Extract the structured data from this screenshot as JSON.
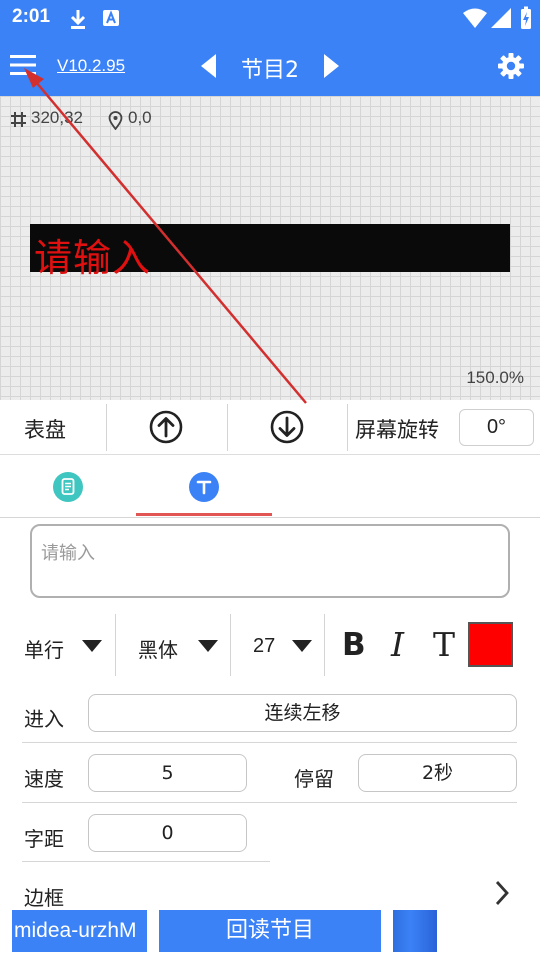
{
  "status_bar": {
    "time": "2:01"
  },
  "app_bar": {
    "version": "V10.2.95",
    "program_title": "节目2"
  },
  "canvas": {
    "size_readout": "320,32",
    "position_readout": "0,0",
    "led_text": "请输入",
    "led_text_color": "#e01010",
    "zoom": "150.0%"
  },
  "controls": {
    "dial_label": "表盘",
    "rotate_label": "屏幕旋转",
    "rotate_value": "0°"
  },
  "tabs": [
    {
      "icon": "document-icon",
      "active": false
    },
    {
      "icon": "text-t-icon",
      "active": true
    }
  ],
  "text_editor": {
    "placeholder": "请输入",
    "value": ""
  },
  "font_row": {
    "line_mode": "单行",
    "font_family": "黑体",
    "font_size": "27",
    "bold_label": "B",
    "italic_label": "I",
    "text_label": "T",
    "color": "#ff0000"
  },
  "form": {
    "enter_label": "进入",
    "enter_value": "连续左移",
    "speed_label": "速度",
    "speed_value": "5",
    "stay_label": "停留",
    "stay_value": "2秒",
    "spacing_label": "字距",
    "spacing_value": "0",
    "border_label": "边框"
  },
  "bottom_bar": {
    "device_name": "midea-urzhM",
    "readback_label": "回读节目"
  },
  "colors": {
    "accent": "#3b82f6",
    "tab_indicator": "#e25555",
    "annotation_arrow": "#d32f2f"
  }
}
